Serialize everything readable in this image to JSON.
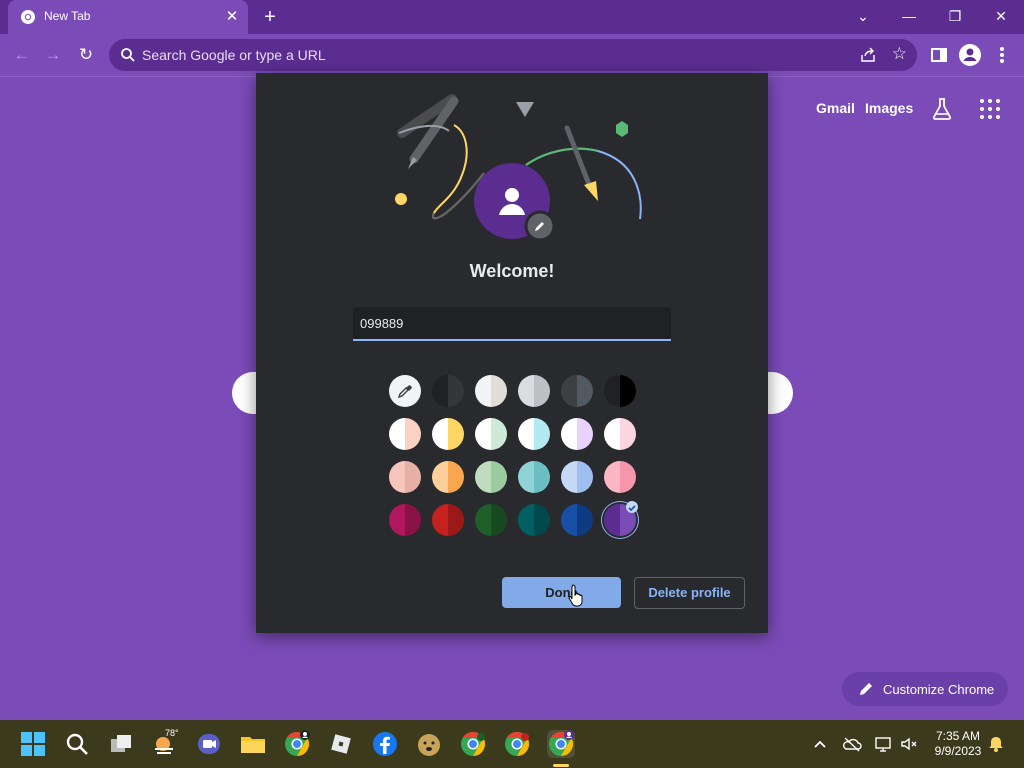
{
  "browser": {
    "tab_title": "New Tab",
    "omnibox_placeholder": "Search Google or type a URL"
  },
  "ntp": {
    "gmail_label": "Gmail",
    "images_label": "Images",
    "customize_label": "Customize Chrome"
  },
  "dialog": {
    "title": "Welcome!",
    "profile_name_value": "099889",
    "done_label": "Done",
    "delete_label": "Delete profile",
    "selected_color_index": 23,
    "swatches": [
      {
        "left": "#f1f3f4",
        "right": "#f1f3f4",
        "type": "picker"
      },
      {
        "left": "#202124",
        "right": "#35363a"
      },
      {
        "left": "#f1f3f4",
        "right": "#e0ddd7"
      },
      {
        "left": "#dadce0",
        "right": "#bdc1c6"
      },
      {
        "left": "#3c4043",
        "right": "#505a60"
      },
      {
        "left": "#202124",
        "right": "#000000"
      },
      {
        "left": "#ffffff",
        "right": "#fad2c3"
      },
      {
        "left": "#ffffff",
        "right": "#fdd663"
      },
      {
        "left": "#ffffff",
        "right": "#ceead6"
      },
      {
        "left": "#ffffff",
        "right": "#b3eaf2"
      },
      {
        "left": "#ffffff",
        "right": "#e9d2fd"
      },
      {
        "left": "#ffffff",
        "right": "#fdd5e0"
      },
      {
        "left": "#f6c6bc",
        "right": "#e6b0a6"
      },
      {
        "left": "#fcd09a",
        "right": "#f9a74e"
      },
      {
        "left": "#bfdcc0",
        "right": "#9bcb9f"
      },
      {
        "left": "#8fd3d6",
        "right": "#6cbec3"
      },
      {
        "left": "#c5d9f7",
        "right": "#9fbef0"
      },
      {
        "left": "#fbb7c4",
        "right": "#f596ab"
      },
      {
        "left": "#b0175c",
        "right": "#8a1246"
      },
      {
        "left": "#c5221f",
        "right": "#9b1a17"
      },
      {
        "left": "#1e5e28",
        "right": "#174a1f"
      },
      {
        "left": "#005f63",
        "right": "#004a4d"
      },
      {
        "left": "#174ea6",
        "right": "#0d3a80"
      },
      {
        "left": "#5b2d91",
        "right": "#7b4bb8"
      }
    ]
  },
  "taskbar": {
    "weather_temp": "78°",
    "time": "7:35 AM",
    "date": "9/9/2023"
  }
}
